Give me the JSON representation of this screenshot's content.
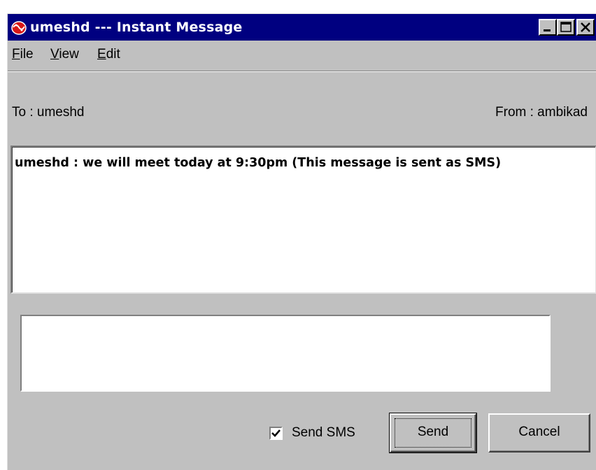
{
  "window": {
    "title": "umeshd --- Instant Message",
    "title_bar_color": "#000080",
    "icon": "app-logo-icon",
    "controls": [
      "minimize-icon",
      "maximize-icon",
      "close-icon"
    ]
  },
  "menu": {
    "items": [
      {
        "mnemonic": "F",
        "rest": "ile"
      },
      {
        "mnemonic": "V",
        "rest": "iew"
      },
      {
        "mnemonic": "E",
        "rest": "dit"
      }
    ]
  },
  "header": {
    "to": "To  : umeshd",
    "from": "From  : ambikad"
  },
  "history": {
    "message": "umeshd : we will meet today at 9:30pm (This message is sent as SMS)"
  },
  "compose": {
    "value": ""
  },
  "footer": {
    "send_sms_label": "Send SMS",
    "send_sms_checked": true,
    "send_label": "Send",
    "cancel_label": "Cancel"
  }
}
